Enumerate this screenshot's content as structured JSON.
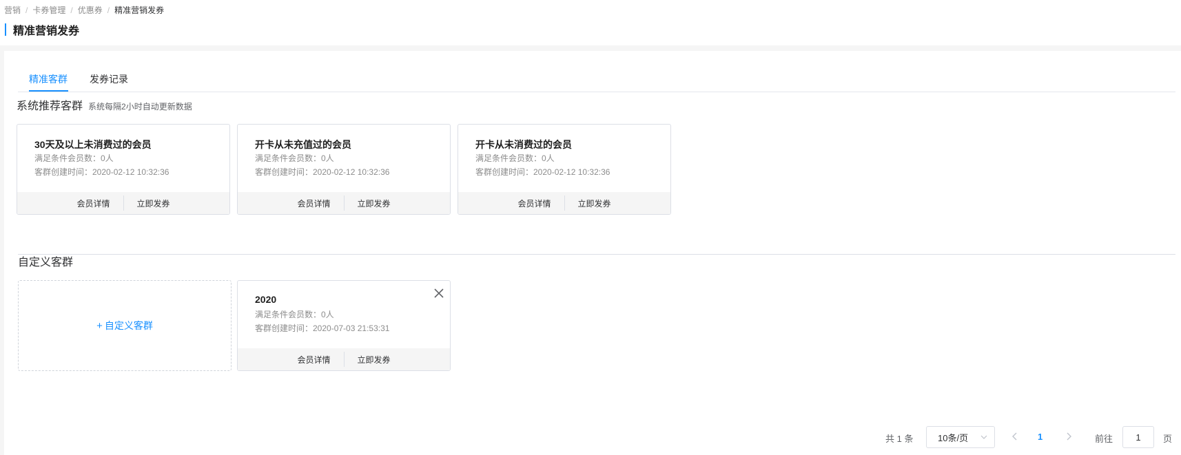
{
  "breadcrumb": {
    "items": [
      "营销",
      "卡券管理",
      "优惠券"
    ],
    "current": "精准营销发券",
    "separator": "/"
  },
  "page_title": "精准营销发券",
  "tabs": [
    {
      "label": "精准客群",
      "active": true
    },
    {
      "label": "发券记录",
      "active": false
    }
  ],
  "system_section": {
    "title": "系统推荐客群",
    "subtitle": "系统每隔2小时自动更新数据",
    "cards": [
      {
        "name": "30天及以上未消费过的会员",
        "count": "满足条件会员数：0人",
        "created": "客群创建时间：2020-02-12 10:32:36",
        "detail_label": "会员详情",
        "send_label": "立即发券"
      },
      {
        "name": "开卡从未充值过的会员",
        "count": "满足条件会员数：0人",
        "created": "客群创建时间：2020-02-12 10:32:36",
        "detail_label": "会员详情",
        "send_label": "立即发券"
      },
      {
        "name": "开卡从未消费过的会员",
        "count": "满足条件会员数：0人",
        "created": "客群创建时间：2020-02-12 10:32:36",
        "detail_label": "会员详情",
        "send_label": "立即发券"
      }
    ]
  },
  "custom_section": {
    "title": "自定义客群",
    "add_label": "自定义客群",
    "add_icon": "plus-icon",
    "cards": [
      {
        "name": "2020",
        "count": "满足条件会员数：0人",
        "created": "客群创建时间：2020-07-03 21:53:31",
        "detail_label": "会员详情",
        "send_label": "立即发券",
        "close_icon": "close-icon"
      }
    ]
  },
  "pagination": {
    "total": "共 1 条",
    "page_size": "10条/页",
    "current_page": "1",
    "goto_label": "前往",
    "goto_value": "1",
    "page_unit": "页"
  },
  "colors": {
    "accent": "#1890ff",
    "background": "#f5f5f5",
    "border": "#dcdfe6",
    "muted_text": "#8c8c8c"
  }
}
